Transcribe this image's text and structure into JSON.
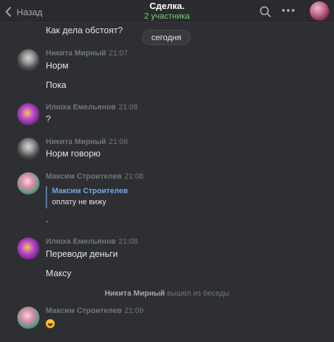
{
  "header": {
    "back_label": "Назад",
    "title": "Сделка.",
    "subtitle": "2 участника"
  },
  "top_message": "Как дела обстоят?",
  "date_separator": "сегодня",
  "messages": [
    {
      "author": "Никита Мирный",
      "time": "21:07",
      "lines": [
        "Норм",
        "Пока"
      ]
    },
    {
      "author": "Илюха Емельянов",
      "time": "21:08",
      "lines": [
        "?"
      ]
    },
    {
      "author": "Никита Мирный",
      "time": "21:08",
      "lines": [
        "Норм говорю"
      ]
    },
    {
      "author": "Максим Строителев",
      "time": "21:08",
      "quote": {
        "author": "Максим Строителев",
        "text": "оплату не вижу"
      },
      "lines": [
        "."
      ]
    },
    {
      "author": "Илюха Емельянов",
      "time": "21:08",
      "lines": [
        "Переводи деньги",
        "Максу"
      ]
    },
    {
      "author": "Максим Строителев",
      "time": "21:09",
      "emoji": "grinning-squint-face"
    }
  ],
  "system_message": {
    "name": "Никита Мирный",
    "action": "вышел из беседы"
  },
  "colors": {
    "background": "#2e2f33",
    "header": "#2a2b2e",
    "subtitle_green": "#7ec87a",
    "link_blue": "#71aaeb"
  }
}
